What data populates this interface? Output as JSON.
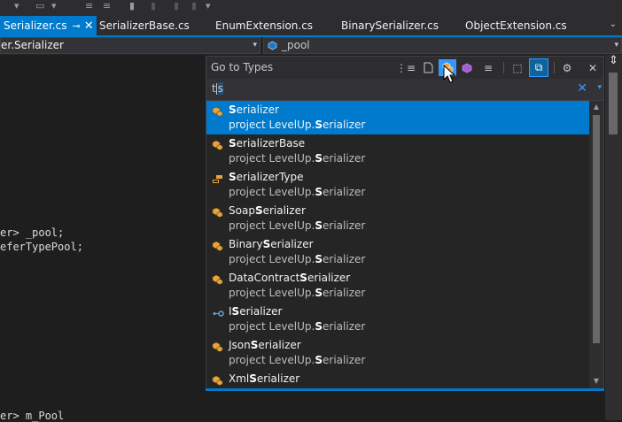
{
  "tabs": [
    {
      "label": "Serializer.cs",
      "pin": "⊸",
      "close": "✕",
      "active": true
    },
    {
      "label": "SerializerBase.cs",
      "active": false
    },
    {
      "label": "EnumExtension.cs",
      "active": false
    },
    {
      "label": "BinarySerializer.cs",
      "active": false
    },
    {
      "label": "ObjectExtension.cs",
      "active": false
    }
  ],
  "tab_overflow_icon": "⌄",
  "navbar": {
    "left_value": "er.Serializer",
    "right_value": "_pool",
    "arrow": "▾"
  },
  "code_lines": [
    {
      "text": "er> _pool;"
    },
    {
      "text": "eferTypePool;"
    },
    {
      "text": "er> m_Pool"
    }
  ],
  "popup": {
    "title": "Go to Types",
    "close": "✕",
    "search": {
      "typed": "t",
      "selected": "s",
      "clear": "✕",
      "dropdown": "▾"
    },
    "buttons": [
      {
        "name": "show-all-icon",
        "glyph": "⋮≡"
      },
      {
        "name": "files-icon",
        "glyph": "🗋"
      },
      {
        "name": "types-icon",
        "glyph": "★"
      },
      {
        "name": "symbols-icon",
        "glyph": "⬢"
      },
      {
        "name": "members-icon",
        "glyph": "≡"
      },
      {
        "name": "current-document-icon",
        "glyph": "⬚"
      },
      {
        "name": "preview-tab-icon",
        "glyph": "⧉"
      },
      {
        "name": "settings-icon",
        "glyph": "⚙"
      }
    ],
    "items": [
      {
        "name_bold": "S",
        "name_rest": "erializer",
        "path_pre": "project LevelUp.",
        "path_bold": "S",
        "path_post": "erializer",
        "kind": "class",
        "selected": true
      },
      {
        "name_bold": "S",
        "name_rest": "erializerBase",
        "path_pre": "project LevelUp.",
        "path_bold": "S",
        "path_post": "erializer",
        "kind": "class",
        "selected": false
      },
      {
        "name_bold": "S",
        "name_rest": "erializerType",
        "path_pre": "project LevelUp.",
        "path_bold": "S",
        "path_post": "erializer",
        "kind": "enum",
        "selected": false
      },
      {
        "name_pre": "Soap",
        "name_bold": "S",
        "name_rest": "erializer",
        "path_pre": "project LevelUp.",
        "path_bold": "S",
        "path_post": "erializer",
        "kind": "class",
        "selected": false
      },
      {
        "name_pre": "Binary",
        "name_bold": "S",
        "name_rest": "erializer",
        "path_pre": "project LevelUp.",
        "path_bold": "S",
        "path_post": "erializer",
        "kind": "class",
        "selected": false
      },
      {
        "name_pre": "DataContract",
        "name_bold": "S",
        "name_rest": "erializer",
        "path_pre": "project LevelUp.",
        "path_bold": "S",
        "path_post": "erializer",
        "kind": "class",
        "selected": false
      },
      {
        "name_pre": "I",
        "name_bold": "S",
        "name_rest": "erializer",
        "path_pre": "project LevelUp.",
        "path_bold": "S",
        "path_post": "erializer",
        "kind": "interface",
        "selected": false
      },
      {
        "name_pre": "Json",
        "name_bold": "S",
        "name_rest": "erializer",
        "path_pre": "project LevelUp.",
        "path_bold": "S",
        "path_post": "erializer",
        "kind": "class",
        "selected": false
      },
      {
        "name_pre": "Xml",
        "name_bold": "S",
        "name_rest": "erializer",
        "path_pre": "",
        "path_bold": "",
        "path_post": "",
        "kind": "class",
        "selected": false
      }
    ]
  },
  "colors": {
    "accent": "#007acc",
    "selection": "#007acc",
    "background": "#1e1e1e",
    "class_icon": "#d19a3b",
    "interface_icon": "#6aa5e0"
  }
}
